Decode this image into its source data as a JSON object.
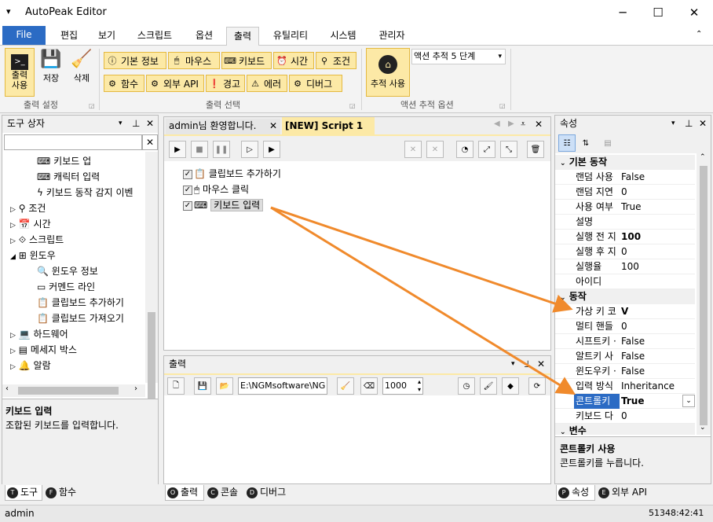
{
  "app": {
    "title": "AutoPeak Editor"
  },
  "menu": {
    "file": "File",
    "tabs": [
      "편집",
      "보기",
      "스크립트",
      "옵션",
      "출력",
      "유틸리티",
      "시스템",
      "관리자"
    ]
  },
  "ribbon": {
    "output_use": "출력\n사용",
    "save": "저장",
    "delete": "삭제",
    "output_settings": "출력 설정",
    "buttons": [
      "기본 정보",
      "마우스",
      "키보드",
      "시간",
      "조건",
      "함수",
      "외부 API",
      "경고",
      "에러",
      "디버그"
    ],
    "output_select": "출력 선택",
    "track_use": "추적 사용",
    "track_option": "액션 추적 5 단계",
    "track_options_label": "액션 추적 옵션"
  },
  "toolbox": {
    "title": "도구 상자",
    "items": [
      "키보드 업",
      "캐릭터 입력",
      "키보드 동작 감지 이벤",
      "조건",
      "시간",
      "스크립트",
      "윈도우",
      "윈도우 정보",
      "커멘드 라인",
      "클립보드 추가하기",
      "클립보드 가져오기",
      "하드웨어",
      "메세지 박스",
      "알람"
    ],
    "desc_title": "키보드 입력",
    "desc_text": "조합된 키보드를 입력합니다.",
    "tabs": [
      "도구",
      "함수"
    ]
  },
  "editor": {
    "tabs": [
      "admin님 환영합니다.",
      "[NEW] Script 1"
    ],
    "nodes": [
      "클립보드 추가하기",
      "마우스 클릭",
      "키보드 입력"
    ]
  },
  "output": {
    "title": "출력",
    "path": "E:\\NGMsoftware\\NG",
    "count": "1000",
    "tabs": [
      "출력",
      "콘솔",
      "디버그"
    ]
  },
  "properties": {
    "title": "속성",
    "cat_basic": "기본 동작",
    "basic": [
      [
        "랜덤 사용",
        "False"
      ],
      [
        "랜덤 지연",
        "0"
      ],
      [
        "사용 여부",
        "True"
      ],
      [
        "설명",
        ""
      ],
      [
        "실행 전 지",
        "100"
      ],
      [
        "실행 후 지",
        "0"
      ],
      [
        "실행율",
        "100"
      ],
      [
        "아이디",
        ""
      ]
    ],
    "cat_action": "동작",
    "action": [
      [
        "가상 키 코",
        "V"
      ],
      [
        "멀티 핸들",
        "0"
      ],
      [
        "시프트키 ·",
        "False"
      ],
      [
        "알트키 사",
        "False"
      ],
      [
        "윈도우키 ·",
        "False"
      ],
      [
        "입력 방식",
        "Inheritance"
      ],
      [
        "콘트롤키",
        "True"
      ],
      [
        "키보드 다",
        "0"
      ]
    ],
    "cat_var": "변수",
    "desc_title": "콘트롤키 사용",
    "desc_text": "콘트롤키를 누릅니다.",
    "tabs": [
      "속성",
      "외부 API"
    ]
  },
  "status": {
    "user": "admin",
    "time": "51348:42:41"
  },
  "colors": {
    "accent": "#2b6bc4",
    "highlight": "#fce9a6",
    "arrow": "#f08a2c"
  }
}
